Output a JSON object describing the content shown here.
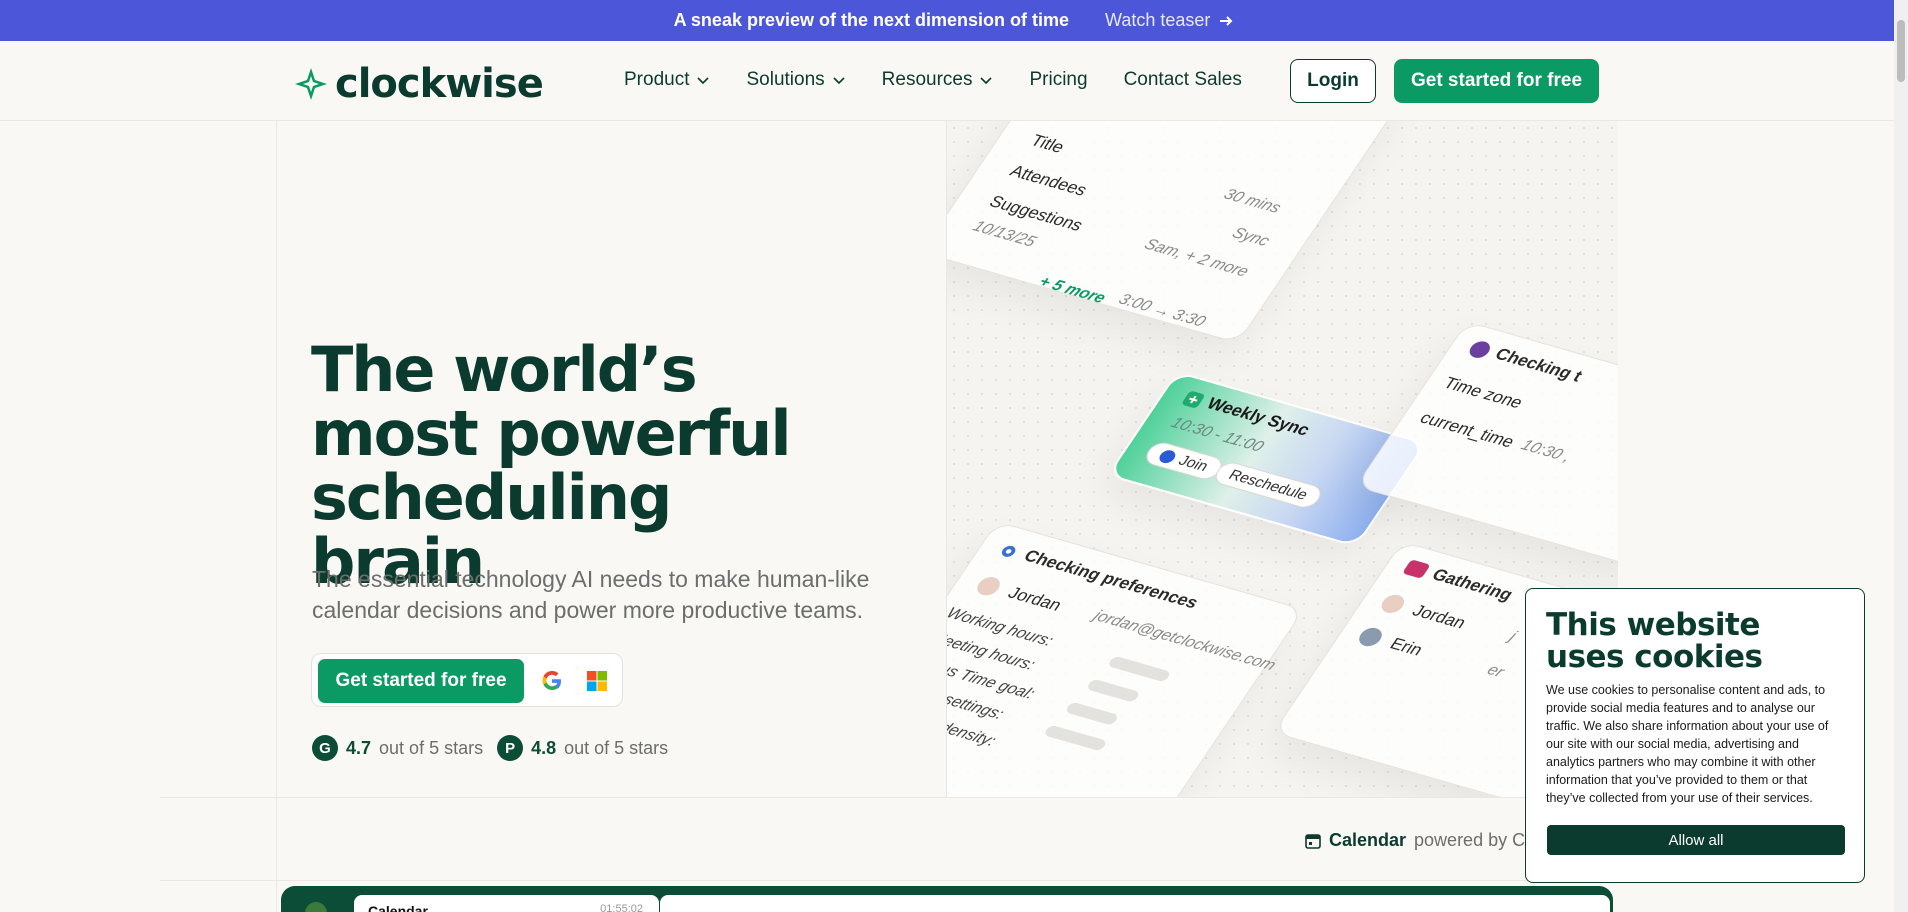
{
  "announcement": {
    "message": "A sneak preview of the next dimension of time",
    "link_label": "Watch teaser"
  },
  "nav": {
    "logo_text": "clockwise",
    "items": [
      {
        "label": "Product",
        "has_menu": true
      },
      {
        "label": "Solutions",
        "has_menu": true
      },
      {
        "label": "Resources",
        "has_menu": true
      },
      {
        "label": "Pricing",
        "has_menu": false
      },
      {
        "label": "Contact Sales",
        "has_menu": false
      }
    ],
    "login_label": "Login",
    "cta_label": "Get started for free"
  },
  "hero": {
    "headline_1": "The world’s",
    "headline_2": "most powerful",
    "headline_3": "scheduling brain",
    "subhead": "The essential technology AI needs to make human-like calendar decisions and power more productive teams.",
    "cta_label": "Get started for free",
    "ratings": [
      {
        "badge": "G",
        "score": "4.7",
        "suffix": "out of 5 stars"
      },
      {
        "badge": "P",
        "score": "4.8",
        "suffix": "out of 5 stars"
      }
    ]
  },
  "illustration": {
    "top_card": {
      "title": "Title",
      "title_val": "30 mins",
      "attendees": "Attendees",
      "attendees_val": "Sync",
      "suggestions": "Suggestions",
      "suggestions_val": "Sam, + 2 more",
      "date": "10/13/25",
      "time": "3:00 → 3:30",
      "more": "+ 5 more"
    },
    "sync_card": {
      "title": "Weekly Sync",
      "time": "10:30 - 11:00",
      "join": "Join",
      "reschedule": "Reschedule"
    },
    "pref_card": {
      "title": "Checking preferences",
      "person": "Jordan",
      "email": "jordan@getclockwise.com",
      "rows": [
        "Working hours:",
        "Meeting hours:",
        "Focus Time goal:",
        "Lunch settings:",
        "Meeting density:"
      ]
    },
    "check_card": {
      "title": "Checking t",
      "row1": "Time zone",
      "row2": "current_time",
      "row2_val": "10:30 ,"
    },
    "gather_card": {
      "title": "Gathering",
      "person1": "Jordan",
      "person1_val": "j",
      "person2": "Erin",
      "person2_val": "er"
    }
  },
  "calendar_strip": {
    "label_bold": "Calendar",
    "label_rest": "powered by C",
    "app_title": "Calendar",
    "app_time": "01:55:02"
  },
  "cookie": {
    "title": "This website uses cookies",
    "body": "We use cookies to personalise content and ads, to provide social media features and to analyse our traffic. We also share information about your use of our site with our social media, advertising and analytics partners who may combine it with other information that you’ve provided to them or that they’ve collected from your use of their services.",
    "allow_label": "Allow all"
  },
  "colors": {
    "brand_green": "#0c9a64",
    "dark_green": "#0b3b2e",
    "announce_bg": "#4b56d8"
  }
}
